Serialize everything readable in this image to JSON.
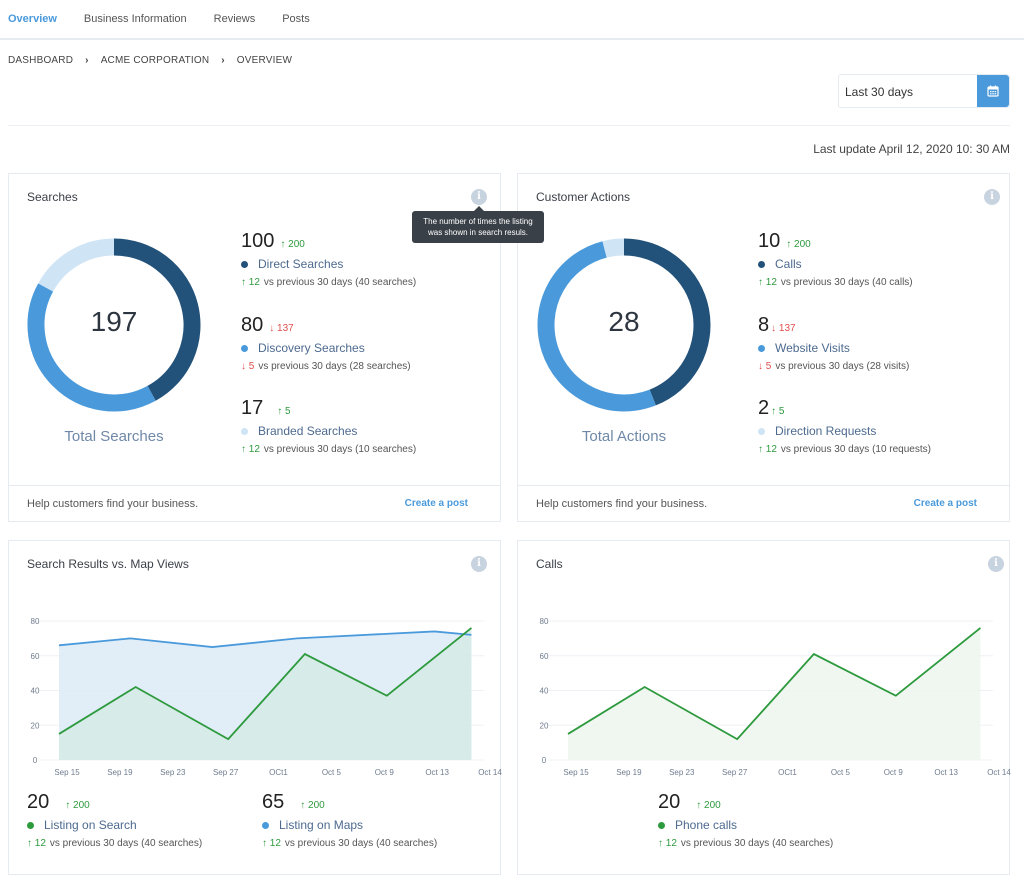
{
  "nav": {
    "tabs": [
      {
        "label": "Overview",
        "active": true
      },
      {
        "label": "Business Information",
        "active": false
      },
      {
        "label": "Reviews",
        "active": false
      },
      {
        "label": "Posts",
        "active": false
      }
    ]
  },
  "breadcrumb": [
    "DASHBOARD",
    "ACME CORPORATION",
    "OVERVIEW"
  ],
  "date_range": {
    "value": "Last 30 days",
    "icon": "calendar-icon"
  },
  "last_update": "Last update April 12, 2020 10: 30 AM",
  "colors": {
    "accent": "#4a9adb",
    "dark_blue": "#22527a",
    "mid_blue": "#4a9adb",
    "light_blue": "#cfe4f5",
    "green": "#2e9a3e",
    "red": "#e0504f"
  },
  "tooltip": {
    "text": "The number of times the listing was shown in search resuls."
  },
  "searches_card": {
    "title": "Searches",
    "total": "197",
    "total_label": "Total Searches",
    "metrics": [
      {
        "value": "100",
        "delta": "↑ 200",
        "dir": "up",
        "name": "Direct Searches",
        "cmp_delta": "↑ 12",
        "cmp_dir": "up",
        "cmp_text": "vs previous 30 days (40 searches)",
        "color": "#22527a"
      },
      {
        "value": "80",
        "delta": "↓ 137",
        "dir": "down",
        "name": "Discovery Searches",
        "cmp_delta": "↓ 5",
        "cmp_dir": "down",
        "cmp_text": "vs previous 30 days (28 searches)",
        "color": "#4a9adb"
      },
      {
        "value": "17",
        "delta": "↑ 5",
        "dir": "up",
        "name": "Branded Searches",
        "cmp_delta": "↑ 12",
        "cmp_dir": "up",
        "cmp_text": "vs previous 30 days (10 searches)",
        "color": "#cfe4f5"
      }
    ],
    "footer_text": "Help customers find your business.",
    "footer_link": "Create a post"
  },
  "actions_card": {
    "title": "Customer Actions",
    "total": "28",
    "total_label": "Total Actions",
    "metrics": [
      {
        "value": "10",
        "delta": "↑ 200",
        "dir": "up",
        "name": "Calls",
        "cmp_delta": "↑ 12",
        "cmp_dir": "up",
        "cmp_text": "vs previous 30 days (40 calls)",
        "color": "#22527a"
      },
      {
        "value": "8",
        "delta": "↓ 137",
        "dir": "down",
        "name": "Website Visits",
        "cmp_delta": "↓ 5",
        "cmp_dir": "down",
        "cmp_text": "vs previous 30 days (28 visits)",
        "color": "#4a9adb"
      },
      {
        "value": "2",
        "delta": "↑ 5",
        "dir": "up",
        "name": "Direction Requests",
        "cmp_delta": "↑ 12",
        "cmp_dir": "up",
        "cmp_text": "vs previous 30 days (10 requests)",
        "color": "#cfe4f5"
      }
    ],
    "footer_text": "Help customers find your business.",
    "footer_link": "Create a post"
  },
  "map_views_card": {
    "title": "Search Results vs. Map Views",
    "metrics": [
      {
        "value": "20",
        "delta": "↑ 200",
        "dir": "up",
        "name": "Listing on Search",
        "cmp_delta": "↑ 12",
        "cmp_dir": "up",
        "cmp_text": "vs previous 30 days (40 searches)",
        "color": "#2e9a3e"
      },
      {
        "value": "65",
        "delta": "↑ 200",
        "dir": "up",
        "name": "Listing on Maps",
        "cmp_delta": "↑ 12",
        "cmp_dir": "up",
        "cmp_text": "vs previous 30 days (40 searches)",
        "color": "#4a9adb"
      }
    ]
  },
  "calls_card": {
    "title": "Calls",
    "metrics": [
      {
        "value": "20",
        "delta": "↑ 200",
        "dir": "up",
        "name": "Phone calls",
        "cmp_delta": "↑ 12",
        "cmp_dir": "up",
        "cmp_text": "vs previous 30 days (40 searches)",
        "color": "#2e9a3e"
      }
    ]
  },
  "chart_data": [
    {
      "type": "pie",
      "title": "Searches",
      "center_label": "197",
      "labels": [
        "Direct Searches",
        "Discovery Searches",
        "Branded Searches"
      ],
      "values": [
        100,
        80,
        17
      ],
      "displayed_fractions": [
        0.42,
        0.41,
        0.17
      ],
      "colors": [
        "#22527a",
        "#4a9adb",
        "#cfe4f5"
      ]
    },
    {
      "type": "pie",
      "title": "Customer Actions",
      "center_label": "28",
      "labels": [
        "Calls",
        "Website Visits",
        "Direction Requests"
      ],
      "values": [
        10,
        8,
        2
      ],
      "displayed_fractions": [
        0.44,
        0.52,
        0.04
      ],
      "colors": [
        "#22527a",
        "#4a9adb",
        "#cfe4f5"
      ]
    },
    {
      "type": "area",
      "title": "Search Results vs. Map Views",
      "x": [
        "Sep 15",
        "Sep 19",
        "Sep 23",
        "Sep 27",
        "OCt1",
        "Oct 5",
        "Oct 9",
        "Oct 13",
        "Oct 14"
      ],
      "xticks": [
        "Sep 15",
        "Sep 19",
        "Sep 23",
        "Sep 27",
        "OCt1",
        "Oct 5",
        "Oct 9",
        "Oct 13",
        "Oct 14"
      ],
      "yticks": [
        0,
        20,
        40,
        60,
        80
      ],
      "ylim": [
        0,
        80
      ],
      "grid": true,
      "series": [
        {
          "name": "Listing on Maps",
          "color": "#4a9adb",
          "fill": "#dcebf7",
          "points": [
            [
              0,
              66
            ],
            [
              1.35,
              70
            ],
            [
              2.9,
              65
            ],
            [
              4.5,
              70
            ],
            [
              7.1,
              74
            ],
            [
              7.8,
              72
            ]
          ]
        },
        {
          "name": "Listing on Search",
          "color": "#2e9a3e",
          "fill": "#d5eae6",
          "points": [
            [
              0,
              15
            ],
            [
              1.45,
              42
            ],
            [
              3.2,
              12
            ],
            [
              4.65,
              61
            ],
            [
              6.2,
              37
            ],
            [
              7.8,
              76
            ]
          ]
        }
      ]
    },
    {
      "type": "area",
      "title": "Calls",
      "x": [
        "Sep 15",
        "Sep 19",
        "Sep 23",
        "Sep 27",
        "OCt1",
        "Oct 5",
        "Oct 9",
        "Oct 13",
        "Oct 14"
      ],
      "xticks": [
        "Sep 15",
        "Sep 19",
        "Sep 23",
        "Sep 27",
        "OCt1",
        "Oct 5",
        "Oct 9",
        "Oct 13",
        "Oct 14"
      ],
      "yticks": [
        0,
        20,
        40,
        60,
        80
      ],
      "ylim": [
        0,
        80
      ],
      "grid": true,
      "series": [
        {
          "name": "Phone calls",
          "color": "#2e9a3e",
          "fill": "#edf6ef",
          "points": [
            [
              0,
              15
            ],
            [
              1.45,
              42
            ],
            [
              3.2,
              12
            ],
            [
              4.65,
              61
            ],
            [
              6.2,
              37
            ],
            [
              7.8,
              76
            ]
          ]
        }
      ]
    }
  ]
}
